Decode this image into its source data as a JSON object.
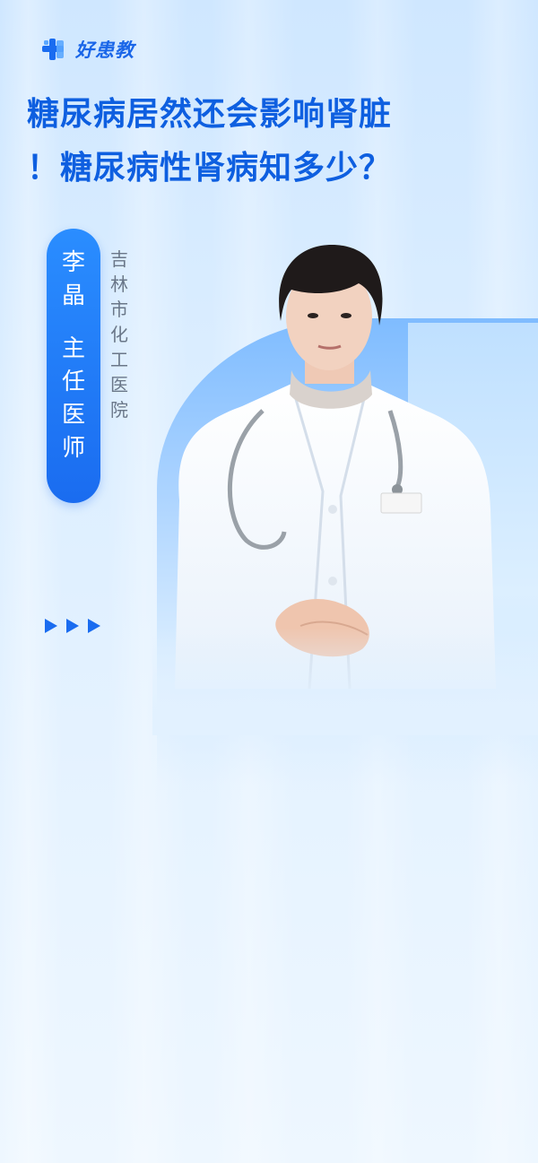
{
  "brand": {
    "name": "好患教",
    "primary_color": "#1a6cf0"
  },
  "title": {
    "line1": "糖尿病居然还会影响肾脏",
    "line2": "！糖尿病性肾病知多少？"
  },
  "doctor": {
    "name_chars": [
      "李",
      "晶"
    ],
    "role_chars": [
      "主",
      "任",
      "医",
      "师"
    ],
    "hospital_chars": [
      "吉",
      "林",
      "市",
      "化",
      "工",
      "医",
      "院"
    ]
  },
  "icons": [
    "logo-icon",
    "play-arrow-icon"
  ]
}
